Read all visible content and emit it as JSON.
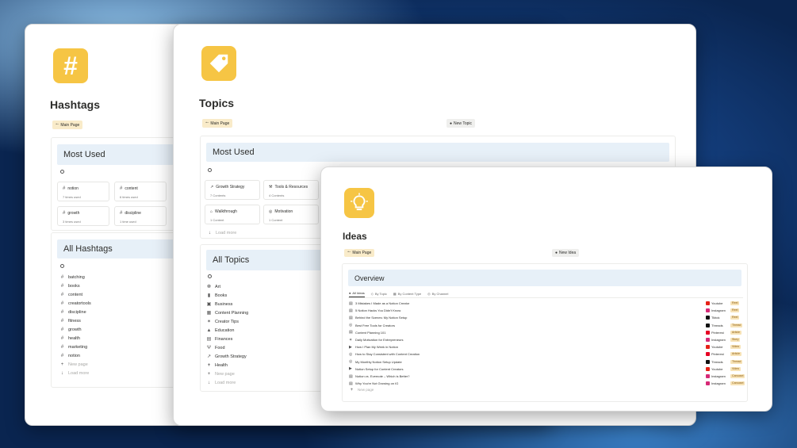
{
  "hashtags": {
    "title": "Hashtags",
    "main_page_btn": "Main Page",
    "most_used_header": "Most Used",
    "most_used": [
      {
        "name": "notion",
        "count": "7 times used"
      },
      {
        "name": "content",
        "count": "6 times used"
      },
      {
        "name": "growth",
        "count": "3 times used"
      },
      {
        "name": "discipline",
        "count": "1 time used"
      }
    ],
    "all_header": "All Hashtags",
    "all": [
      "batching",
      "books",
      "content",
      "creatortools",
      "discipline",
      "fitness",
      "growth",
      "health",
      "marketing",
      "notion"
    ],
    "new_page": "New page",
    "load_more": "Load more"
  },
  "topics": {
    "title": "Topics",
    "main_page_btn": "Main Page",
    "new_topic_btn": "New Topic",
    "most_used_header": "Most Used",
    "most_used": [
      {
        "name": "Growth Strategy",
        "count": "7 Contents",
        "icon": "chart-icon"
      },
      {
        "name": "Tools & Resources",
        "count": "4 Contents",
        "icon": "tools-icon"
      },
      {
        "name": "Walkthrough",
        "count": "1 Content",
        "icon": "home-icon"
      },
      {
        "name": "Motivation",
        "count": "1 Content",
        "icon": "target-icon"
      }
    ],
    "load_more": "Load more",
    "all_header": "All Topics",
    "all": [
      {
        "name": "Art",
        "icon": "palette-icon"
      },
      {
        "name": "Books",
        "icon": "book-icon"
      },
      {
        "name": "Business",
        "icon": "briefcase-icon"
      },
      {
        "name": "Content Planning",
        "icon": "calendar-icon"
      },
      {
        "name": "Creator Tips",
        "icon": "bulb-icon"
      },
      {
        "name": "Education",
        "icon": "graduation-icon"
      },
      {
        "name": "Finances",
        "icon": "money-icon"
      },
      {
        "name": "Food",
        "icon": "fork-icon"
      },
      {
        "name": "Growth Strategy",
        "icon": "chart-icon"
      },
      {
        "name": "Health",
        "icon": "plus-icon"
      }
    ],
    "new_page": "New page",
    "load_more_2": "Load more"
  },
  "ideas": {
    "title": "Ideas",
    "main_page_btn": "Main Page",
    "new_idea_btn": "New Idea",
    "overview_header": "Overview",
    "tabs": [
      "All Ideas",
      "By Topic",
      "By Content Type",
      "By Channel"
    ],
    "rows": [
      {
        "title": "3 Mistakes I Made as a Notion Creator",
        "channel": "Youtube",
        "color": "#e62117",
        "type": "Reel"
      },
      {
        "title": "5 Notion Hacks You Didn't Know",
        "channel": "Instagram",
        "color": "#d62976",
        "type": "Reel"
      },
      {
        "title": "Behind the Scenes: My Notion Setup",
        "channel": "Tiktok",
        "color": "#111111",
        "type": "Reel"
      },
      {
        "title": "Best Free Tools for Creators",
        "channel": "Threads",
        "color": "#111111",
        "type": "Thread"
      },
      {
        "title": "Content Planning 101",
        "channel": "Pinterest",
        "color": "#e60023",
        "type": "Article"
      },
      {
        "title": "Daily Motivation for Entrepreneurs",
        "channel": "Instagram",
        "color": "#d62976",
        "type": "Story"
      },
      {
        "title": "How I Plan My Week in Notion",
        "channel": "Youtube",
        "color": "#e62117",
        "type": "Video"
      },
      {
        "title": "How to Stay Consistent with Content Creation",
        "channel": "Pinterest",
        "color": "#e60023",
        "type": "Article"
      },
      {
        "title": "My Monthly Notion Setup Update",
        "channel": "Threads",
        "color": "#111111",
        "type": "Thread"
      },
      {
        "title": "Notion Setup for Content Creators",
        "channel": "Youtube",
        "color": "#e62117",
        "type": "Video"
      },
      {
        "title": "Notion vs. Evernote – Which is Better?",
        "channel": "Instagram",
        "color": "#d62976",
        "type": "Carousel"
      },
      {
        "title": "Why You're Not Growing on IG",
        "channel": "Instagram",
        "color": "#d62976",
        "type": "Carousel"
      }
    ],
    "new_page": "New page"
  },
  "colors": {
    "accent_yellow": "#f6c544",
    "header_blue": "#e7f0f8",
    "tag_bg": "#f7e3b7"
  }
}
